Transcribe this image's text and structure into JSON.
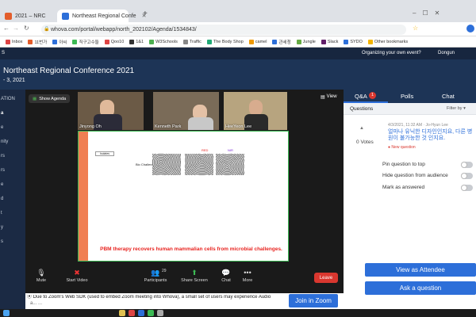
{
  "browser": {
    "tabs": [
      {
        "label": "2021 – NRC",
        "active": false
      },
      {
        "label": "Northeast Regional Confe",
        "active": true
      }
    ],
    "new_tab_glyph": "+",
    "url": "whova.com/portal/webapp/north_202102/Agenda/1534843/",
    "bookmarks": [
      "Inbox",
      "11번가",
      "아씨",
      "직구고수들",
      "Qoo10",
      "1&1",
      "W3Schools",
      "Traffic",
      "The Body Shop",
      "camel",
      "관세청",
      "Jungle",
      "Slack",
      "SYDO",
      "Other bookmarks"
    ]
  },
  "whova": {
    "prompt": "Organizing your own event?",
    "user": "Dongun",
    "conference_title": "Northeast Regional Conference 2021",
    "dates": "- 3, 2021",
    "left_nav": [
      "ATION",
      "a",
      "e",
      "nity",
      "rs",
      "rs",
      "e",
      "d",
      "t",
      "y",
      "s"
    ]
  },
  "zoom": {
    "show_agenda": "Show Agenda",
    "view_label": "View",
    "participants": [
      {
        "name": "Jinyong Oh"
      },
      {
        "name": "Kenneth Park"
      },
      {
        "name": "HeeYeon Lee"
      }
    ],
    "share_banner": "You are viewing Seokku Hwang's screen",
    "view_options": "View Options",
    "slide": {
      "caption": "PBM therapy recovers human mammalian cells from microbial challenges.",
      "row_label": "Bio Challenge",
      "col_labels": [
        "RED",
        "NIR"
      ],
      "corner_label": "Isolates"
    },
    "controls": {
      "mute": "Mute",
      "start_video": "Start Video",
      "participants": "Participants",
      "participant_count": "29",
      "share_screen": "Share Screen",
      "chat": "Chat",
      "more": "More",
      "leave": "Leave"
    },
    "note": "Due to Zoom's Web SDK (used to embed Zoom meeting into Whova), a small set of users may experience Audio",
    "note2": "a... ...",
    "join_zoom": "Join in Zoom"
  },
  "right_panel": {
    "tabs": {
      "qa": "Q&A",
      "qa_badge": "1",
      "polls": "Polls",
      "chat": "Chat"
    },
    "questions_label": "Questions",
    "filter_by": "Filter by",
    "question": {
      "time": "4/3/2021, 11:32 AM",
      "author": "Jo-Hyun Lee",
      "text": "얼마나 유닉한 디자인인지요, 다른 병원이 불가능한 것 인지요.",
      "status": "New question",
      "votes": "0",
      "votes_label": "Votes"
    },
    "options": [
      "Pin question to top",
      "Hide question from audience",
      "Mark as answered"
    ],
    "view_as_attendee": "View as Attendee",
    "ask_question": "Ask a question"
  },
  "colors": {
    "whova_navy": "#1d3456",
    "zoom_dark": "#1a1a1a",
    "leave_red": "#d9372f",
    "button_blue": "#2d6fd9",
    "slide_caption_red": "#e8231f",
    "share_green": "#3cba54"
  }
}
